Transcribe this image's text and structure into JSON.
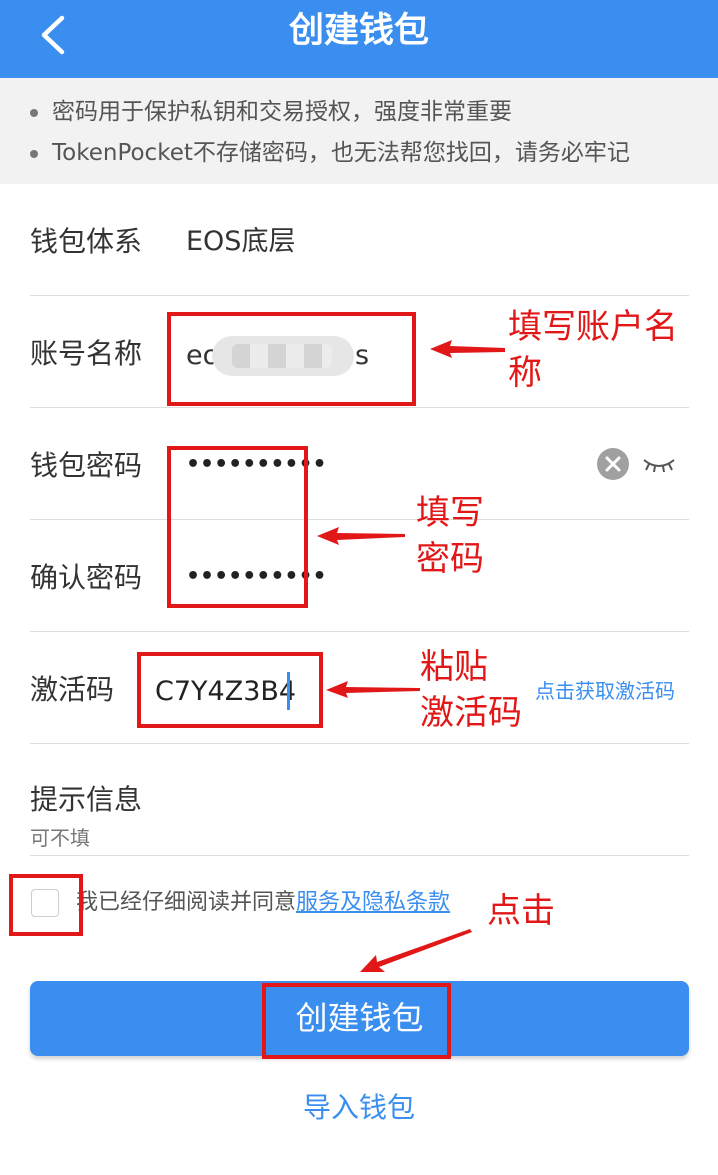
{
  "header": {
    "title": "创建钱包"
  },
  "tips": [
    "密码用于保护私钥和交易授权，强度非常重要",
    "TokenPocket不存储密码，也无法帮您找回，请务必牢记"
  ],
  "form": {
    "wallet_system": {
      "label": "钱包体系",
      "value": "EOS底层"
    },
    "account_name": {
      "label": "账号名称",
      "value_start": "eo",
      "value_end": "s"
    },
    "password": {
      "label": "钱包密码",
      "value": "••••••••••"
    },
    "confirm_password": {
      "label": "确认密码",
      "value": "••••••••••"
    },
    "activation_code": {
      "label": "激活码",
      "value": "C7Y4Z3B4",
      "link": "点击获取激活码"
    },
    "hint": {
      "label": "提示信息",
      "placeholder": "可不填"
    }
  },
  "agreement": {
    "text": "我已经仔细阅读并同意",
    "link": "服务及隐私条款"
  },
  "create_button": "创建钱包",
  "import_link": "导入钱包",
  "annotations": {
    "account": "填写账户名称",
    "account_line2": "称",
    "password_line1": "填写",
    "password_line2": "密码",
    "code_line1": "粘贴",
    "code_line2": "激活码",
    "click": "点击"
  },
  "colors": {
    "accent": "#3a8ef0",
    "annotation": "#e21818"
  }
}
